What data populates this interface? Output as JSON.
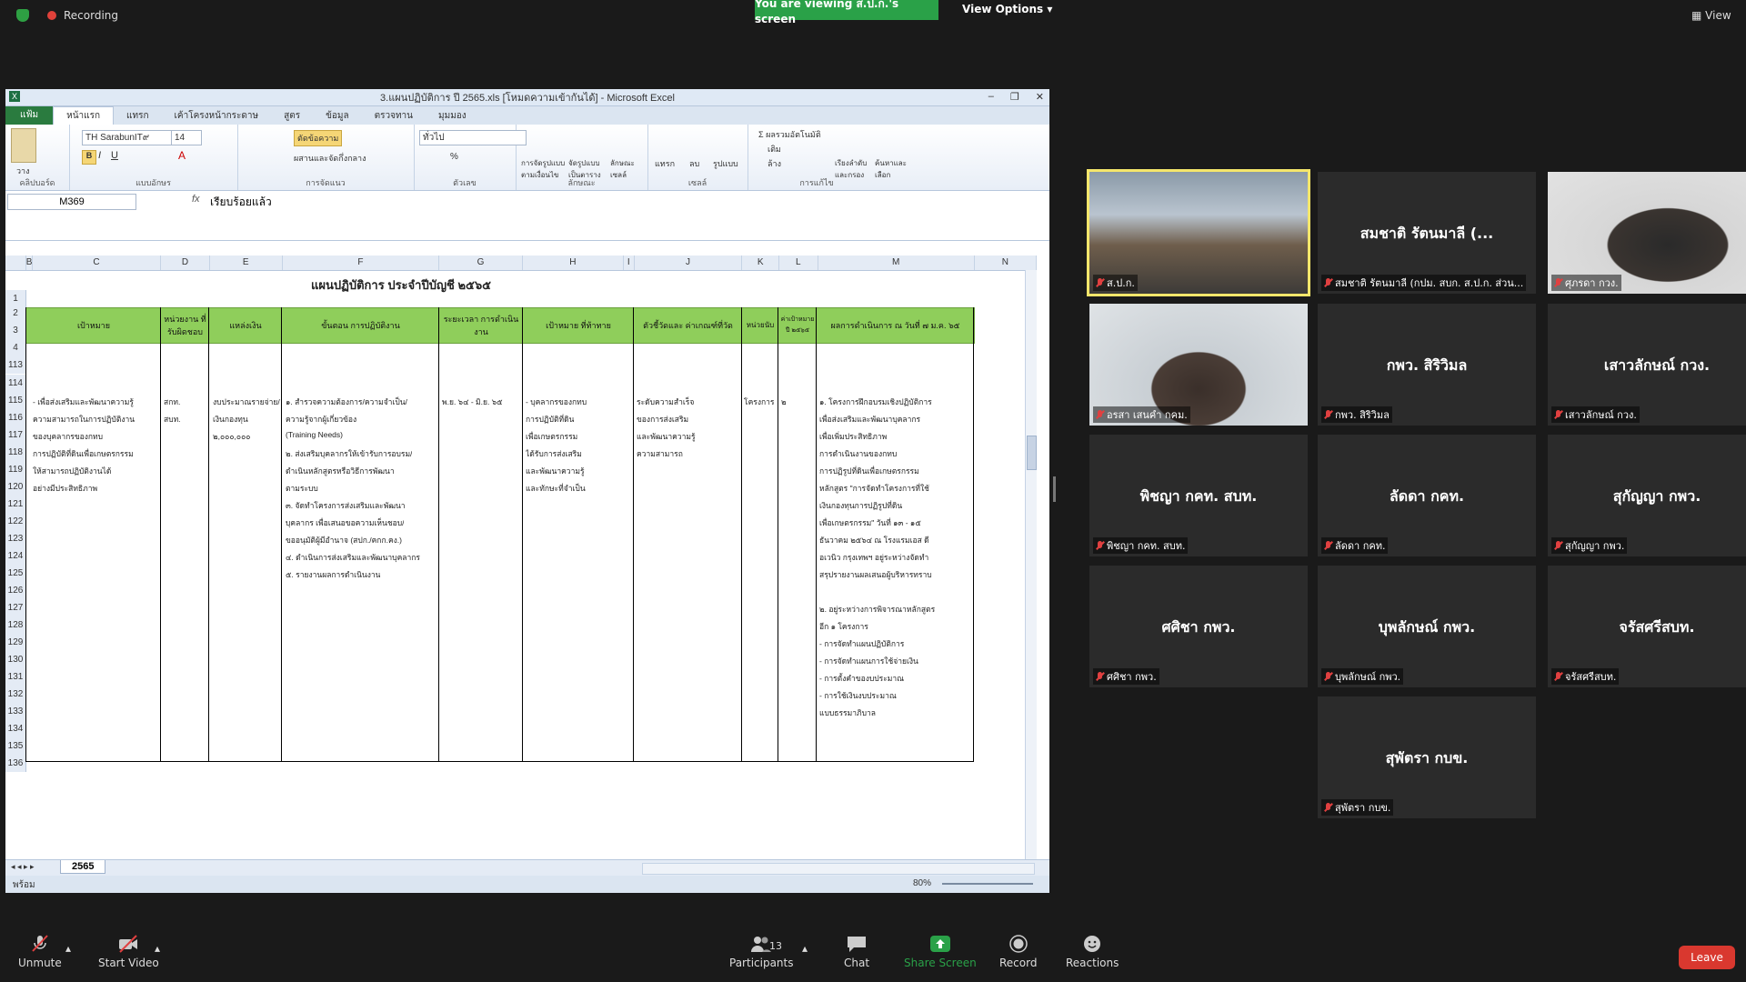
{
  "topbar": {
    "recording": "Recording",
    "viewing_banner": "You are viewing ส.ป.ก.'s screen",
    "view_options": "View Options",
    "view": "View"
  },
  "excel": {
    "title": "3.แผนปฏิบัติการ ปี 2565.xls  [โหมดความเข้ากันได้] - Microsoft Excel",
    "tabs": [
      "แฟ้ม",
      "หน้าแรก",
      "แทรก",
      "เค้าโครงหน้ากระดาษ",
      "สูตร",
      "ข้อมูล",
      "ตรวจทาน",
      "มุมมอง"
    ],
    "ribbon": {
      "clipboard": "คลิปบอร์ด",
      "paste": "วาง",
      "font_group": "แบบอักษร",
      "font_name": "TH SarabunIT๙",
      "font_size": "14",
      "align_group": "การจัดแนว",
      "wrap": "ตัดข้อความ",
      "merge": "ผสานและจัดกึ่งกลาง",
      "number_group": "ตัวเลข",
      "number_format": "ทั่วไป",
      "styles_group": "ลักษณะ",
      "cond_format": "การจัดรูปแบบตามเงื่อนไข",
      "format_table": "จัดรูปแบบเป็นตาราง",
      "cell_styles": "ลักษณะเซลล์",
      "cells_group": "เซลล์",
      "insert": "แทรก",
      "delete": "ลบ",
      "format": "รูปแบบ",
      "edit_group": "การแก้ไข",
      "autosum": "ผลรวมอัตโนมัติ",
      "fill": "เติม",
      "clear": "ล้าง",
      "sort": "เรียงลำดับและกรอง",
      "find": "ค้นหาและเลือก"
    },
    "name_box": "M369",
    "formula": "เรียบร้อยแล้ว",
    "columns": [
      "B",
      "C",
      "D",
      "E",
      "F",
      "G",
      "H",
      "I",
      "J",
      "K",
      "L",
      "M",
      "N"
    ],
    "sheet_title": "แผนปฏิบัติการ ประจำปีบัญชี ๒๕๖๕",
    "headers": {
      "c": "เป้าหมาย",
      "d": "หน่วยงาน ที่รับผิดชอบ",
      "e": "แหล่งเงิน",
      "f": "ขั้นตอน การปฏิบัติงาน",
      "g": "ระยะเวลา การดำเนินงาน",
      "h": "เป้าหมาย ที่ท้าทาย",
      "j": "ตัวชี้วัดและ ค่าเกณฑ์ที่วัด",
      "k": "หน่วยนับ",
      "l": "ค่าเป้าหมาย ปี ๒๕๖๕",
      "m": "ผลการดำเนินการ ณ วันที่ ๗ ม.ค. ๖๕"
    },
    "row_numbers": [
      "1",
      "2",
      "3",
      "4",
      "113",
      "114",
      "115",
      "116",
      "117",
      "118",
      "119",
      "120",
      "121",
      "122",
      "123",
      "124",
      "125",
      "126",
      "127",
      "128",
      "129",
      "130",
      "131",
      "132",
      "133",
      "134",
      "135",
      "136"
    ],
    "rows": {
      "r115": {
        "c": "- เพื่อส่งเสริมและพัฒนาความรู้",
        "d": "สกท.",
        "e": "งบประมาณรายจ่าย/",
        "f": "๑. สำรวจความต้องการ/ความจำเป็น/",
        "g": "พ.ย. ๖๔ - มิ.ย. ๖๕",
        "h": "- บุคลากรของกทบ",
        "j": "ระดับความสำเร็จ",
        "k": "โครงการ",
        "l": "๒",
        "m": "๑. โครงการฝึกอบรมเชิงปฏิบัติการ"
      },
      "r116": {
        "c": "ความสามารถในการปฏิบัติงาน",
        "d": "สบท.",
        "e": "เงินกองทุน",
        "f": "ความรู้จากผู้เกี่ยวข้อง",
        "h": "การปฏิบัติที่ดิน",
        "j": "ของการส่งเสริม",
        "m": "เพื่อส่งเสริมและพัฒนาบุคลากร"
      },
      "r117": {
        "c": "ของบุคลากรของกทบ",
        "e": "๒,๐๐๐,๐๐๐",
        "f": "(Training Needs)",
        "h": "เพื่อเกษตรกรรม",
        "j": "และพัฒนาความรู้",
        "m": "เพื่อเพิ่มประสิทธิภาพ"
      },
      "r118": {
        "c": "การปฏิบัติที่ดินเพื่อเกษตรกรรม",
        "f": "๒. ส่งเสริมบุคลากรให้เข้ารับการอบรม/",
        "h": "ได้รับการส่งเสริม",
        "j": "ความสามารถ",
        "m": "การดำเนินงานของกทบ"
      },
      "r119": {
        "c": "ให้สามารถปฏิบัติงานได้",
        "f": "ดำเนินหลักสูตรหรือวิธีการพัฒนา",
        "h": "และพัฒนาความรู้",
        "m": "การปฏิรูปที่ดินเพื่อเกษตรกรรม"
      },
      "r120": {
        "c": "อย่างมีประสิทธิภาพ",
        "f": "ตามระบบ",
        "h": "และทักษะที่จำเป็น",
        "m": "หลักสูตร \"การจัดทำโครงการที่ใช้"
      },
      "r121": {
        "f": "๓. จัดทำโครงการส่งเสริมและพัฒนา",
        "m": "เงินกองทุนการปฏิรูปที่ดิน"
      },
      "r122": {
        "f": "บุคลากร เพื่อเสนอขอความเห็นชอบ/",
        "m": "เพื่อเกษตรกรรม\" วันที่ ๑๓ - ๑๕"
      },
      "r123": {
        "f": "ขออนุมัติผู้มีอำนาจ (สปก./คกก.คง.)",
        "m": "ธันวาคม ๒๕๖๔ ณ โรงแรมเอส ดี"
      },
      "r124": {
        "f": "๔. ดำเนินการส่งเสริมและพัฒนาบุคลากร",
        "m": "อเวนิว กรุงเทพฯ อยู่ระหว่างจัดทำ"
      },
      "r125": {
        "f": "๕. รายงานผลการดำเนินงาน",
        "m": "สรุปรายงานผลเสนอผู้บริหารทราบ"
      },
      "r127": {
        "m": "๒. อยู่ระหว่างการพิจารณาหลักสูตร"
      },
      "r128": {
        "m": "อีก ๑ โครงการ"
      },
      "r129": {
        "m": "- การจัดทำแผนปฏิบัติการ"
      },
      "r130": {
        "m": "- การจัดทำแผนการใช้จ่ายเงิน"
      },
      "r131": {
        "m": "- การตั้งคำของบประมาณ"
      },
      "r132": {
        "m": "- การใช้เงินงบประมาณ"
      },
      "r133": {
        "m": "แบบธรรมาภิบาล"
      }
    },
    "sheet_tab": "2565",
    "status": "พร้อม",
    "zoom": "80%"
  },
  "gallery": [
    {
      "name": "",
      "label": "ส.ป.ก.",
      "video": true,
      "active": true
    },
    {
      "name": "สมชาติ รัตนมาลี (...",
      "label": "สมชาติ รัตนมาลี (กปม. สบก. ส.ป.ก. ส่วน...",
      "video": false
    },
    {
      "name": "",
      "label": "ศุภรดา กวง.",
      "video": true
    },
    {
      "name": "",
      "label": "อรสา เสนคำ กคม.",
      "video": true
    },
    {
      "name": "กพว. สิริวิมล",
      "label": "กพว. สิริวิมล",
      "video": false
    },
    {
      "name": "เสาวลักษณ์ กวง.",
      "label": "เสาวลักษณ์ กวง.",
      "video": false
    },
    {
      "name": "พิชญา กคท. สบท.",
      "label": "พิชญา กคท. สบท.",
      "video": false
    },
    {
      "name": "ลัดดา กคท.",
      "label": "ลัดดา กคท.",
      "video": false
    },
    {
      "name": "สุกัญญา กพว.",
      "label": "สุกัญญา กพว.",
      "video": false
    },
    {
      "name": "ศศิชา กพว.",
      "label": "ศศิชา กพว.",
      "video": false
    },
    {
      "name": "บุพลักษณ์ กพว.",
      "label": "บุพลักษณ์ กพว.",
      "video": false
    },
    {
      "name": "จรัสศรีสบท.",
      "label": "จรัสศรีสบท.",
      "video": false
    },
    {
      "name": "สุพัตรา กบข.",
      "label": "สุพัตรา กบข.",
      "video": false
    }
  ],
  "toolbar": {
    "unmute": "Unmute",
    "start_video": "Start Video",
    "participants": "Participants",
    "participant_count": "13",
    "chat": "Chat",
    "share_screen": "Share Screen",
    "record": "Record",
    "reactions": "Reactions",
    "leave": "Leave"
  },
  "colors": {
    "share_green": "#2aa148",
    "leave_red": "#d9382f",
    "header_green": "#8fce5b",
    "active_border": "#f5e66b"
  }
}
